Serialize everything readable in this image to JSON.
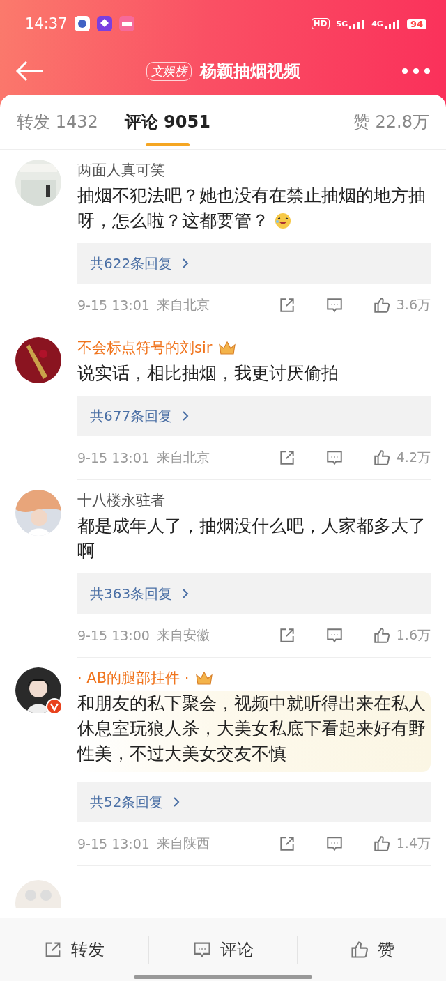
{
  "status_bar": {
    "time": "14:37",
    "hd": "HD",
    "networks": [
      "5G",
      "4G"
    ],
    "battery": "94"
  },
  "header": {
    "badge": "文娱榜",
    "title": "杨颖抽烟视频"
  },
  "tabs": [
    {
      "label": "转发 1432",
      "selected": false
    },
    {
      "label": "评论 9051",
      "selected": true
    },
    {
      "label": "赞 22.8万",
      "selected": false
    }
  ],
  "comments": [
    {
      "name": "两面人真可笑",
      "vip": false,
      "verified": false,
      "text": "抽烟不犯法吧？她也没有在禁止抽烟的地方抽呀，怎么啦？这都要管？",
      "emoji": true,
      "highlighted": false,
      "replies": "共622条回复",
      "time": "9-15 13:01",
      "location": "来自北京",
      "likes": "3.6万"
    },
    {
      "name": "不会标点符号的刘sir",
      "vip": true,
      "verified": false,
      "text": "说实话，相比抽烟，我更讨厌偷拍",
      "emoji": false,
      "highlighted": false,
      "replies": "共677条回复",
      "time": "9-15 13:01",
      "location": "来自北京",
      "likes": "4.2万"
    },
    {
      "name": "十八楼永驻者",
      "vip": false,
      "verified": false,
      "text": "都是成年人了，抽烟没什么吧，人家都多大了啊",
      "emoji": false,
      "highlighted": false,
      "replies": "共363条回复",
      "time": "9-15 13:00",
      "location": "来自安徽",
      "likes": "1.6万"
    },
    {
      "name": "· AB的腿部挂件 ·",
      "vip": true,
      "verified": true,
      "text": "和朋友的私下聚会，视频中就听得出来在私人休息室玩狼人杀，大美女私底下看起来好有野性美，不过大美女交友不慎",
      "emoji": false,
      "highlighted": true,
      "replies": "共52条回复",
      "time": "9-15 13:01",
      "location": "来自陕西",
      "likes": "1.4万"
    }
  ],
  "bottom_bar": [
    {
      "kind": "repost",
      "label": "转发"
    },
    {
      "kind": "comment",
      "label": "评论"
    },
    {
      "kind": "like",
      "label": "赞"
    }
  ]
}
